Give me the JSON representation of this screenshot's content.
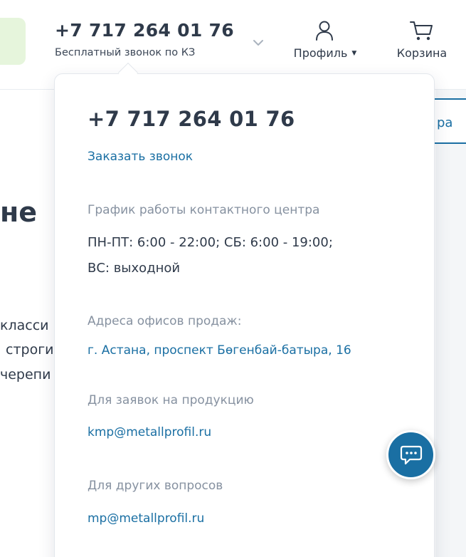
{
  "header": {
    "phone": "+7 717 264 01 76",
    "phone_note": "Бесплатный звонок по КЗ",
    "profile_label": "Профиль",
    "cart_label": "Корзина"
  },
  "background": {
    "heading_fragment": "не",
    "button_fragment": "ра",
    "text_lines": [
      "класси",
      "строги",
      "черепи"
    ]
  },
  "dropdown": {
    "phone": "+7 717 264 01 76",
    "order_call": "Заказать звонок",
    "schedule_title": "График работы контактного центра",
    "schedule_line1": "ПН-ПТ:  6:00 - 22:00; СБ:  6:00 - 19:00;",
    "schedule_line2": "ВС:  выходной",
    "offices_title": "Адреса офисов продаж:",
    "office_address": "г. Астана, проспект Бөгенбай-батыра, 16",
    "products_title": "Для заявок на продукцию",
    "products_email": "kmp@metallprofil.ru",
    "other_title": "Для других вопросов",
    "other_email": "mp@metallprofil.ru"
  },
  "colors": {
    "accent": "#1a6fa3",
    "text": "#2f3a4a",
    "muted": "#8691a0",
    "green_tint": "#e6f5dc"
  },
  "icons": {
    "chevron": "chevron-down-icon",
    "profile": "user-icon",
    "cart": "cart-icon",
    "chat": "chat-icon"
  }
}
